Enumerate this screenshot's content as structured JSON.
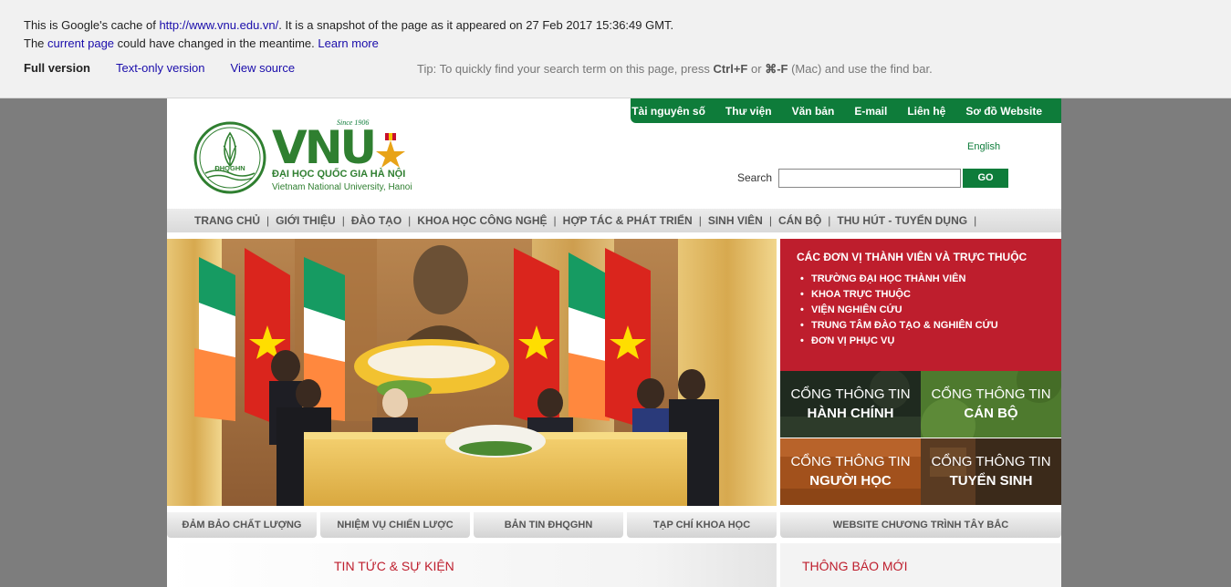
{
  "cache_header": {
    "line1_prefix": "This is Google's cache of",
    "cached_url": "http://www.vnu.edu.vn/",
    "line1_suffix": ". It is a snapshot of the page as it appeared on 27 Feb 2017 15:36:49 GMT.",
    "line2_prefix": "The",
    "current_page_link": "current page",
    "line2_middle": "could have changed in the meantime.",
    "learn_more_link": "Learn more",
    "full_version": "Full version",
    "text_only_version": "Text-only version",
    "view_source": "View source",
    "tip_prefix": "Tip: To quickly find your search term on this page, press",
    "tip_key1": "Ctrl+F",
    "tip_or": "or",
    "tip_key2": "⌘-F",
    "tip_suffix": "(Mac) and use the find bar."
  },
  "top_links": [
    "Tài nguyên số",
    "Thư viện",
    "Văn bản",
    "E-mail",
    "Liên hệ",
    "Sơ đồ Website"
  ],
  "logo": {
    "emblem_text": "ĐHQGHN",
    "since": "Since 1906",
    "brand": "VNU",
    "name_vn": "ĐẠI HỌC QUỐC GIA HÀ NỘI",
    "name_en": "Vietnam National University, Hanoi"
  },
  "language_link": "English",
  "search": {
    "label": "Search",
    "value": "",
    "button": "GO"
  },
  "main_nav": [
    "TRANG CHỦ",
    "GIỚI THIỆU",
    "ĐÀO TẠO",
    "KHOA HỌC CÔNG NGHỆ",
    "HỢP TÁC & PHÁT TRIỂN",
    "SINH VIÊN",
    "CÁN BỘ",
    "THU HÚT - TUYỂN DỤNG"
  ],
  "units": {
    "title": "CÁC ĐƠN VỊ THÀNH VIÊN VÀ TRỰC THUỘC",
    "items": [
      "TRƯỜNG ĐẠI HỌC THÀNH VIÊN",
      "KHOA TRỰC THUỘC",
      "VIỆN NGHIÊN CỨU",
      "TRUNG TÂM ĐÀO TẠO & NGHIÊN CỨU",
      "ĐƠN VỊ PHỤC VỤ"
    ]
  },
  "portals": {
    "admin": {
      "line1": "CỔNG THÔNG TIN",
      "line2": "HÀNH CHÍNH"
    },
    "staff": {
      "line1": "CỔNG THÔNG TIN",
      "line2": "CÁN BỘ"
    },
    "learner": {
      "line1": "CỔNG THÔNG TIN",
      "line2": "NGƯỜI HỌC"
    },
    "admission": {
      "line1": "CỔNG THÔNG TIN",
      "line2": "TUYỂN SINH"
    }
  },
  "sub_tabs": [
    "ĐẢM BẢO CHẤT LƯỢNG",
    "NHIỆM VỤ CHIẾN LƯỢC",
    "BẢN TIN ĐHQGHN",
    "TẠP CHÍ KHOA HỌC",
    "WEBSITE CHƯƠNG TRÌNH TÂY BẮC"
  ],
  "news_title": "TIN TỨC & SỰ KIỆN",
  "notice_title": "THÔNG BÁO MỚI",
  "colors": {
    "green": "#0e7c3a",
    "red": "#be1e2d"
  }
}
